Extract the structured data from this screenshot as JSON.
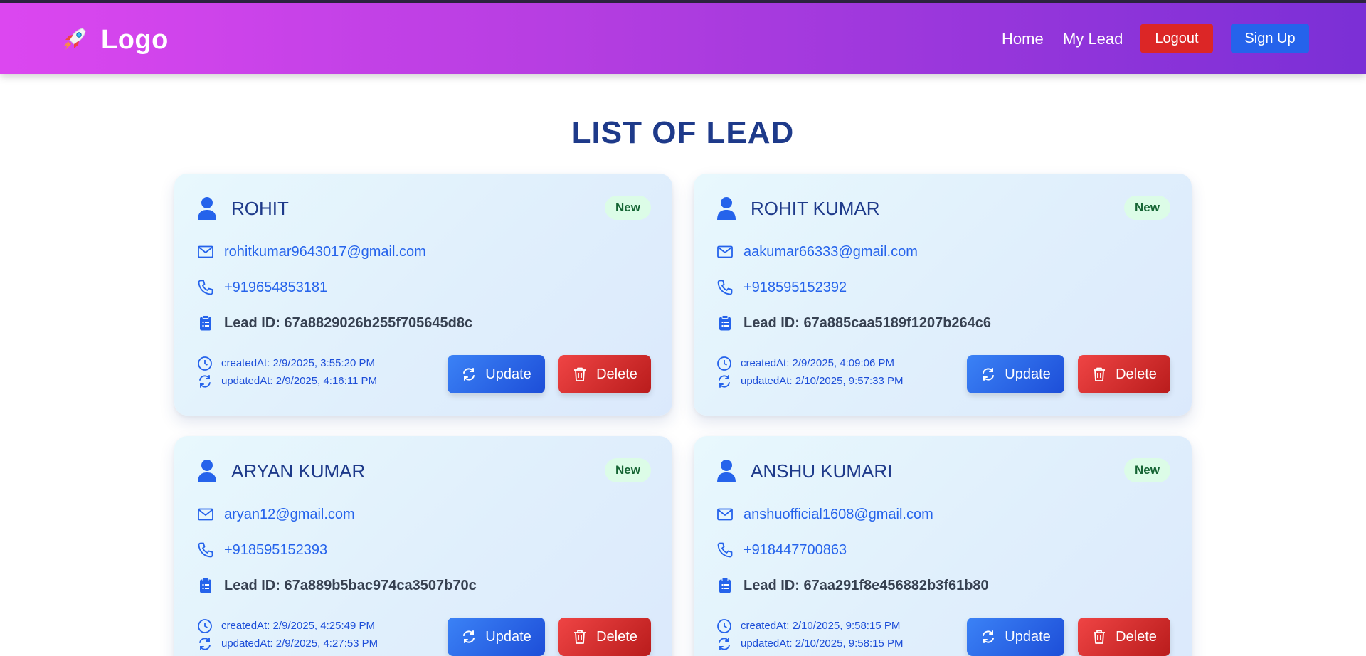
{
  "navbar": {
    "brand": "Logo",
    "links": {
      "home": "Home",
      "my_lead": "My Lead"
    },
    "buttons": {
      "logout": "Logout",
      "signup": "Sign Up"
    }
  },
  "page": {
    "title": "LIST OF LEAD"
  },
  "labels": {
    "update": "Update",
    "delete": "Delete"
  },
  "leads": [
    {
      "name": "ROHIT",
      "status": "New",
      "email": "rohitkumar9643017@gmail.com",
      "phone": "+919654853181",
      "lead_id": "Lead ID: 67a8829026b255f705645d8c",
      "created_at": "createdAt: 2/9/2025, 3:55:20 PM",
      "updated_at": "updatedAt: 2/9/2025, 4:16:11 PM"
    },
    {
      "name": "ROHIT KUMAR",
      "status": "New",
      "email": "aakumar66333@gmail.com",
      "phone": "+918595152392",
      "lead_id": "Lead ID: 67a885caa5189f1207b264c6",
      "created_at": "createdAt: 2/9/2025, 4:09:06 PM",
      "updated_at": "updatedAt: 2/10/2025, 9:57:33 PM"
    },
    {
      "name": "ARYAN KUMAR",
      "status": "New",
      "email": "aryan12@gmail.com",
      "phone": "+918595152393",
      "lead_id": "Lead ID: 67a889b5bac974ca3507b70c",
      "created_at": "createdAt: 2/9/2025, 4:25:49 PM",
      "updated_at": "updatedAt: 2/9/2025, 4:27:53 PM"
    },
    {
      "name": "ANSHU KUMARI",
      "status": "New",
      "email": "anshuofficial1608@gmail.com",
      "phone": "+918447700863",
      "lead_id": "Lead ID: 67aa291f8e456882b3f61b80",
      "created_at": "createdAt: 2/10/2025, 9:58:15 PM",
      "updated_at": "updatedAt: 2/10/2025, 9:58:15 PM"
    }
  ],
  "colors": {
    "navbar_start": "#dc47f0",
    "navbar_end": "#7b2fd6",
    "title": "#1e3a8a",
    "logout": "#dc2626",
    "signup": "#2563eb",
    "update": "#2563eb",
    "delete": "#dc2626",
    "badge_bg": "#dcfce7",
    "badge_text": "#166534"
  },
  "icons": {
    "brand": "rocket-icon",
    "name": "user-icon",
    "email": "mail-icon",
    "phone": "phone-icon",
    "lead_id": "clipboard-icon",
    "created": "clock-icon",
    "updated": "refresh-icon",
    "update_button": "refresh-icon",
    "delete_button": "trash-icon"
  }
}
